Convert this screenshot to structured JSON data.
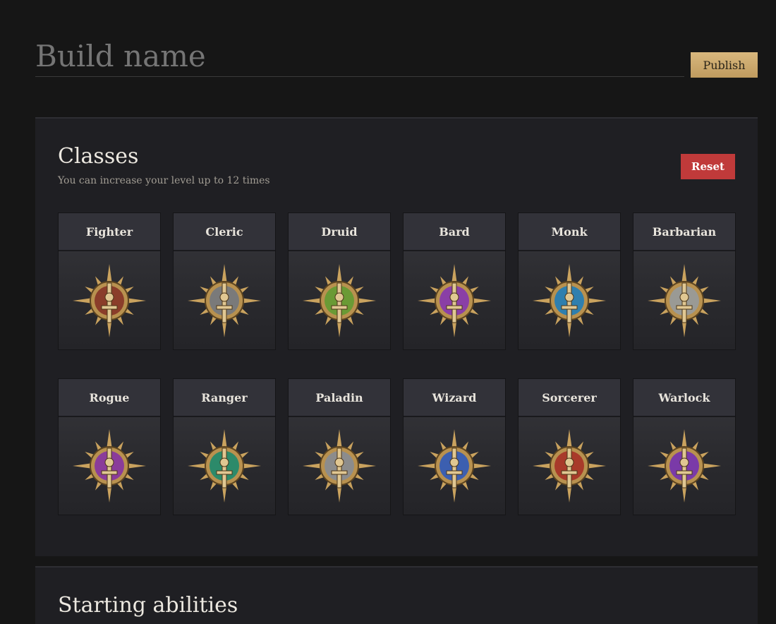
{
  "header": {
    "build_name_placeholder": "Build name",
    "publish_label": "Publish"
  },
  "classes": {
    "title": "Classes",
    "subtitle": "You can increase your level up to 12 times",
    "reset_label": "Reset",
    "items": [
      {
        "label": "Fighter",
        "icon": "fighter-emblem-icon",
        "accent": "#8a3d2a"
      },
      {
        "label": "Cleric",
        "icon": "cleric-emblem-icon",
        "accent": "#7a7a7a"
      },
      {
        "label": "Druid",
        "icon": "druid-emblem-icon",
        "accent": "#6a9a35"
      },
      {
        "label": "Bard",
        "icon": "bard-emblem-icon",
        "accent": "#8a3fa6"
      },
      {
        "label": "Monk",
        "icon": "monk-emblem-icon",
        "accent": "#2f7fae"
      },
      {
        "label": "Barbarian",
        "icon": "barbarian-emblem-icon",
        "accent": "#9a9a95"
      },
      {
        "label": "Rogue",
        "icon": "rogue-emblem-icon",
        "accent": "#8a3c9a"
      },
      {
        "label": "Ranger",
        "icon": "ranger-emblem-icon",
        "accent": "#2c8a6a"
      },
      {
        "label": "Paladin",
        "icon": "paladin-emblem-icon",
        "accent": "#8c8c8c"
      },
      {
        "label": "Wizard",
        "icon": "wizard-emblem-icon",
        "accent": "#3c5fb0"
      },
      {
        "label": "Sorcerer",
        "icon": "sorcerer-emblem-icon",
        "accent": "#a83a2a"
      },
      {
        "label": "Warlock",
        "icon": "warlock-emblem-icon",
        "accent": "#7a3aa8"
      }
    ]
  },
  "starting_abilities": {
    "title": "Starting abilities"
  }
}
